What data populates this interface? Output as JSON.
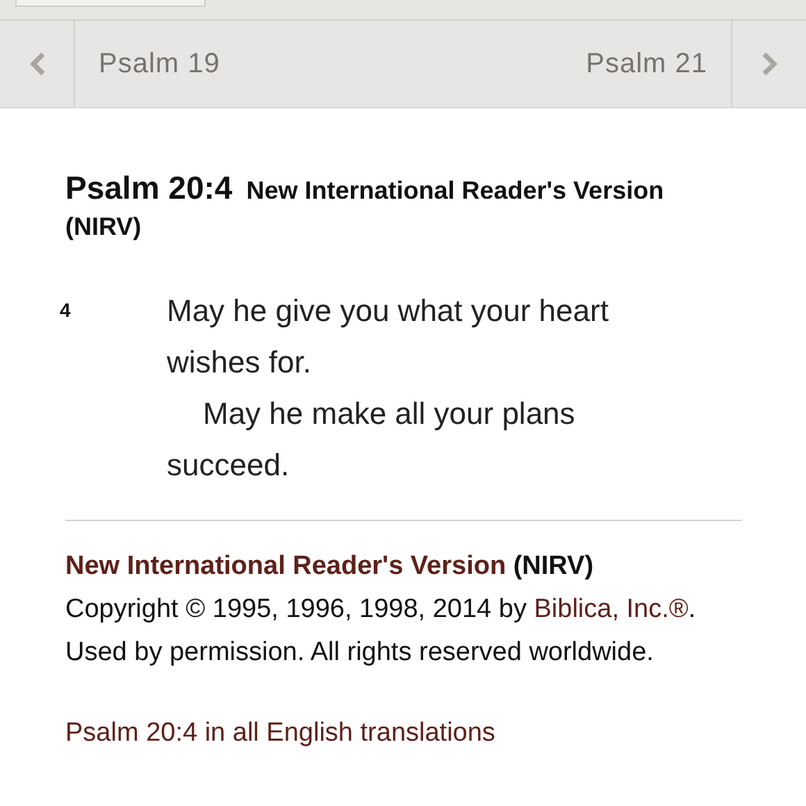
{
  "nav": {
    "previous": "Psalm 19",
    "next": "Psalm 21"
  },
  "passage": {
    "reference": "Psalm 20:4",
    "version": "New International Reader's Version (NIRV)",
    "verse_number": "4",
    "lines": [
      {
        "kind": "line",
        "text": "May he give you what your heart wishes for."
      },
      {
        "kind": "indent",
        "text": "May he make all your plans succeed."
      }
    ]
  },
  "footer": {
    "version_link": "New International Reader's Version",
    "version_abbr": "(NIRV)",
    "copyright_before": "Copyright © 1995, 1996, 1998, 2014 by",
    "publisher_link": "Biblica, Inc.®",
    "copyright_after": ". Used by permission. All rights reserved worldwide.",
    "all_translations_link": "Psalm 20:4 in all English translations"
  }
}
